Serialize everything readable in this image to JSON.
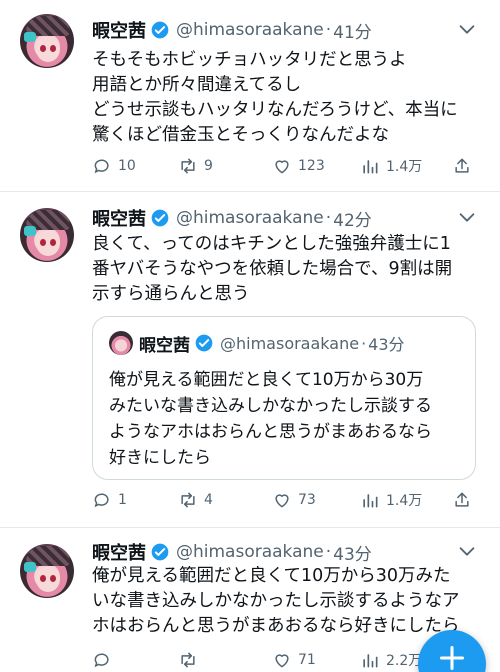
{
  "colors": {
    "accent": "#1d9bf0",
    "secondary_text": "#536471",
    "text": "#0f1419"
  },
  "tweets": [
    {
      "name": "暇空茜",
      "handle": "@himasoraakane",
      "sep": "·",
      "time": "41分",
      "lines": [
        "そもそもホビッチョハッタリだと思うよ",
        "用語とか所々間違えてるし",
        "どうせ示談もハッタリなんだろうけど、本当に",
        "驚くほど借金玉とそっくりなんだよな"
      ],
      "replies": "10",
      "retweets": "9",
      "likes": "123",
      "views": "1.4万"
    },
    {
      "name": "暇空茜",
      "handle": "@himasoraakane",
      "sep": "·",
      "time": "42分",
      "lines": [
        "良くて、ってのはキチンとした強強弁護士に1",
        "番ヤバそうなやつを依頼した場合で、9割は開",
        "示すら通らんと思う"
      ],
      "quote": {
        "name": "暇空茜",
        "handle": "@himasoraakane",
        "sep": "·",
        "time": "43分",
        "lines": [
          "俺が見える範囲だと良くて10万から30万",
          "みたいな書き込みしかなかったし示談する",
          "ようなアホはおらんと思うがまあおるなら",
          "好きにしたら"
        ]
      },
      "replies": "1",
      "retweets": "4",
      "likes": "73",
      "views": "1.4万"
    },
    {
      "name": "暇空茜",
      "handle": "@himasoraakane",
      "sep": "·",
      "time": "43分",
      "lines": [
        "俺が見える範囲だと良くて10万から30万みた",
        "いな書き込みしかなかったし示談するようなア",
        "ホはおらんと思うがまあおるなら好きにしたら"
      ],
      "replies": "",
      "retweets": "",
      "likes": "71",
      "views": "2.2万"
    }
  ],
  "icons": {
    "reply": "reply-icon",
    "retweet": "retweet-icon",
    "like": "heart-icon",
    "views": "views-icon",
    "share": "share-icon",
    "more": "chevron-down-icon",
    "compose": "plus-icon"
  }
}
